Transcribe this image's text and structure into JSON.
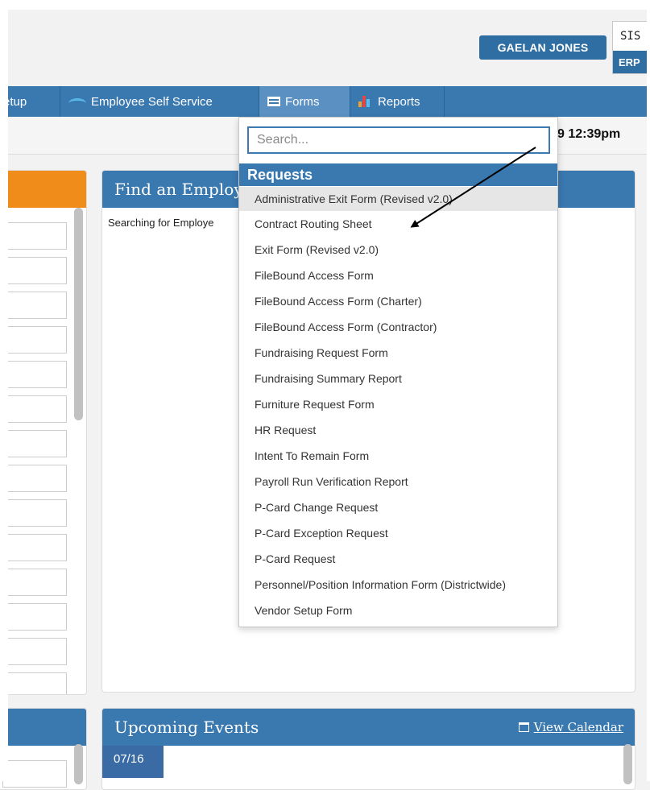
{
  "header": {
    "user_name": "GAELAN JONES",
    "system_top": "SIS",
    "system_bottom": "ERP"
  },
  "nav": {
    "items": [
      {
        "label": "etup"
      },
      {
        "label": "Employee Self Service",
        "icon": "ess-icon"
      },
      {
        "label": "Forms",
        "icon": "forms-icon"
      },
      {
        "label": "Reports",
        "icon": "reports-icon"
      }
    ]
  },
  "subbar": {
    "time": "9 12:39pm"
  },
  "find_employee": {
    "title": "Find an Employ",
    "body": "Searching for Employe"
  },
  "events": {
    "title": "Upcoming Events",
    "view_calendar": "View Calendar",
    "first_date": "07/16"
  },
  "forms_menu": {
    "search_placeholder": "Search...",
    "section_title": "Requests",
    "items": [
      {
        "label": "Administrative Exit Form (Revised v2.0)"
      },
      {
        "label": "Contract Routing Sheet"
      },
      {
        "label": "Exit Form (Revised v2.0)"
      },
      {
        "label": "FileBound Access Form"
      },
      {
        "label": "FileBound Access Form (Charter)"
      },
      {
        "label": "FileBound Access Form (Contractor)"
      },
      {
        "label": "Fundraising Request Form"
      },
      {
        "label": "Fundraising Summary Report"
      },
      {
        "label": "Furniture Request Form"
      },
      {
        "label": "HR Request"
      },
      {
        "label": "Intent To Remain Form"
      },
      {
        "label": "Payroll Run Verification Report"
      },
      {
        "label": "P-Card Change Request"
      },
      {
        "label": "P-Card Exception Request"
      },
      {
        "label": "P-Card Request"
      },
      {
        "label": "Personnel/Position Information Form (Districtwide)"
      },
      {
        "label": "Vendor Setup Form"
      }
    ]
  },
  "colors": {
    "primary": "#3a78b0",
    "accent_orange": "#ef8c1a",
    "button_blue": "#2f6ea3"
  }
}
